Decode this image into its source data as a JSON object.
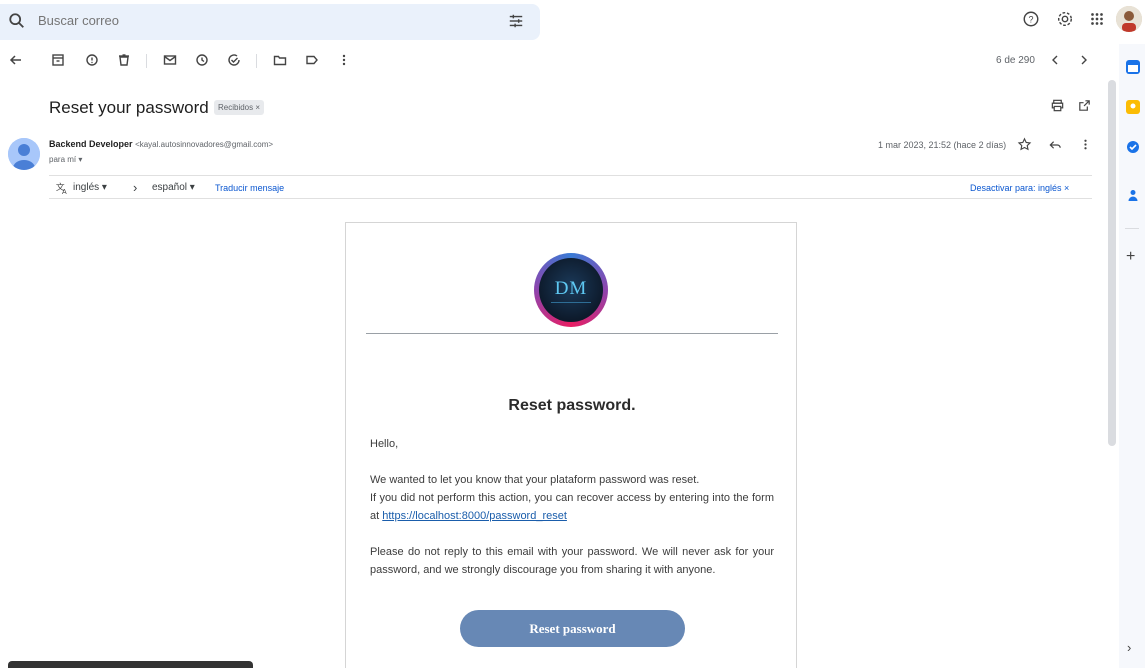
{
  "search": {
    "placeholder": "Buscar correo"
  },
  "toolbar": {
    "counter": "6 de 290"
  },
  "message": {
    "subject": "Reset your password",
    "label": "Recibidos ×",
    "sender_name": "Backend Developer",
    "sender_email": "<kayal.autosinnovadores@gmail.com>",
    "to": "para mí ▾",
    "date": "1 mar 2023, 21:52 (hace 2 días)"
  },
  "translate": {
    "from": "inglés ▾",
    "arrow": "›",
    "to": "español ▾",
    "action": "Traducir mensaje",
    "disable": "Desactivar para: inglés ×"
  },
  "email": {
    "logo_text": "DM",
    "title": "Reset password.",
    "greeting": "Hello,",
    "line1": "We wanted to let you know that your plataform password was reset.",
    "line2": "If you did not perform this action, you can recover access by entering into the form at",
    "link": "https://localhost:8000/password_reset",
    "line3": "Please do not reply to this email with your password. We will never ask for your password, and we strongly discourage you from sharing it with anyone.",
    "button": "Reset password"
  },
  "side_panel": {
    "plus": "+",
    "chevron": "›"
  },
  "colors": {
    "accent": "#0b57d0",
    "button": "#6788b5",
    "search_bg": "#eaf1fb"
  }
}
